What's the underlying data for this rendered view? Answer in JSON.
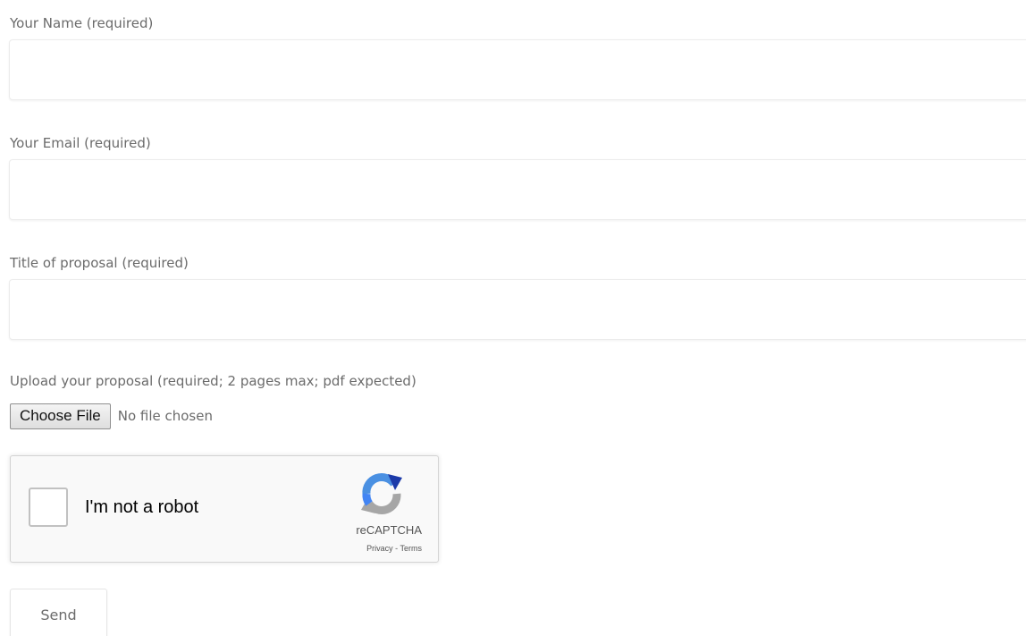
{
  "form": {
    "name": {
      "label": "Your Name (required)",
      "value": ""
    },
    "email": {
      "label": "Your Email (required)",
      "value": ""
    },
    "title": {
      "label": "Title of proposal (required)",
      "value": ""
    },
    "upload": {
      "label": "Upload your proposal (required; 2 pages max; pdf expected)",
      "button_label": "Choose File",
      "status": "No file chosen"
    },
    "captcha": {
      "text": "I'm not a robot",
      "brand": "reCAPTCHA",
      "privacy": "Privacy",
      "separator": " - ",
      "terms": "Terms",
      "icon": "recaptcha-logo-icon",
      "checked": false
    },
    "send_label": "Send"
  }
}
